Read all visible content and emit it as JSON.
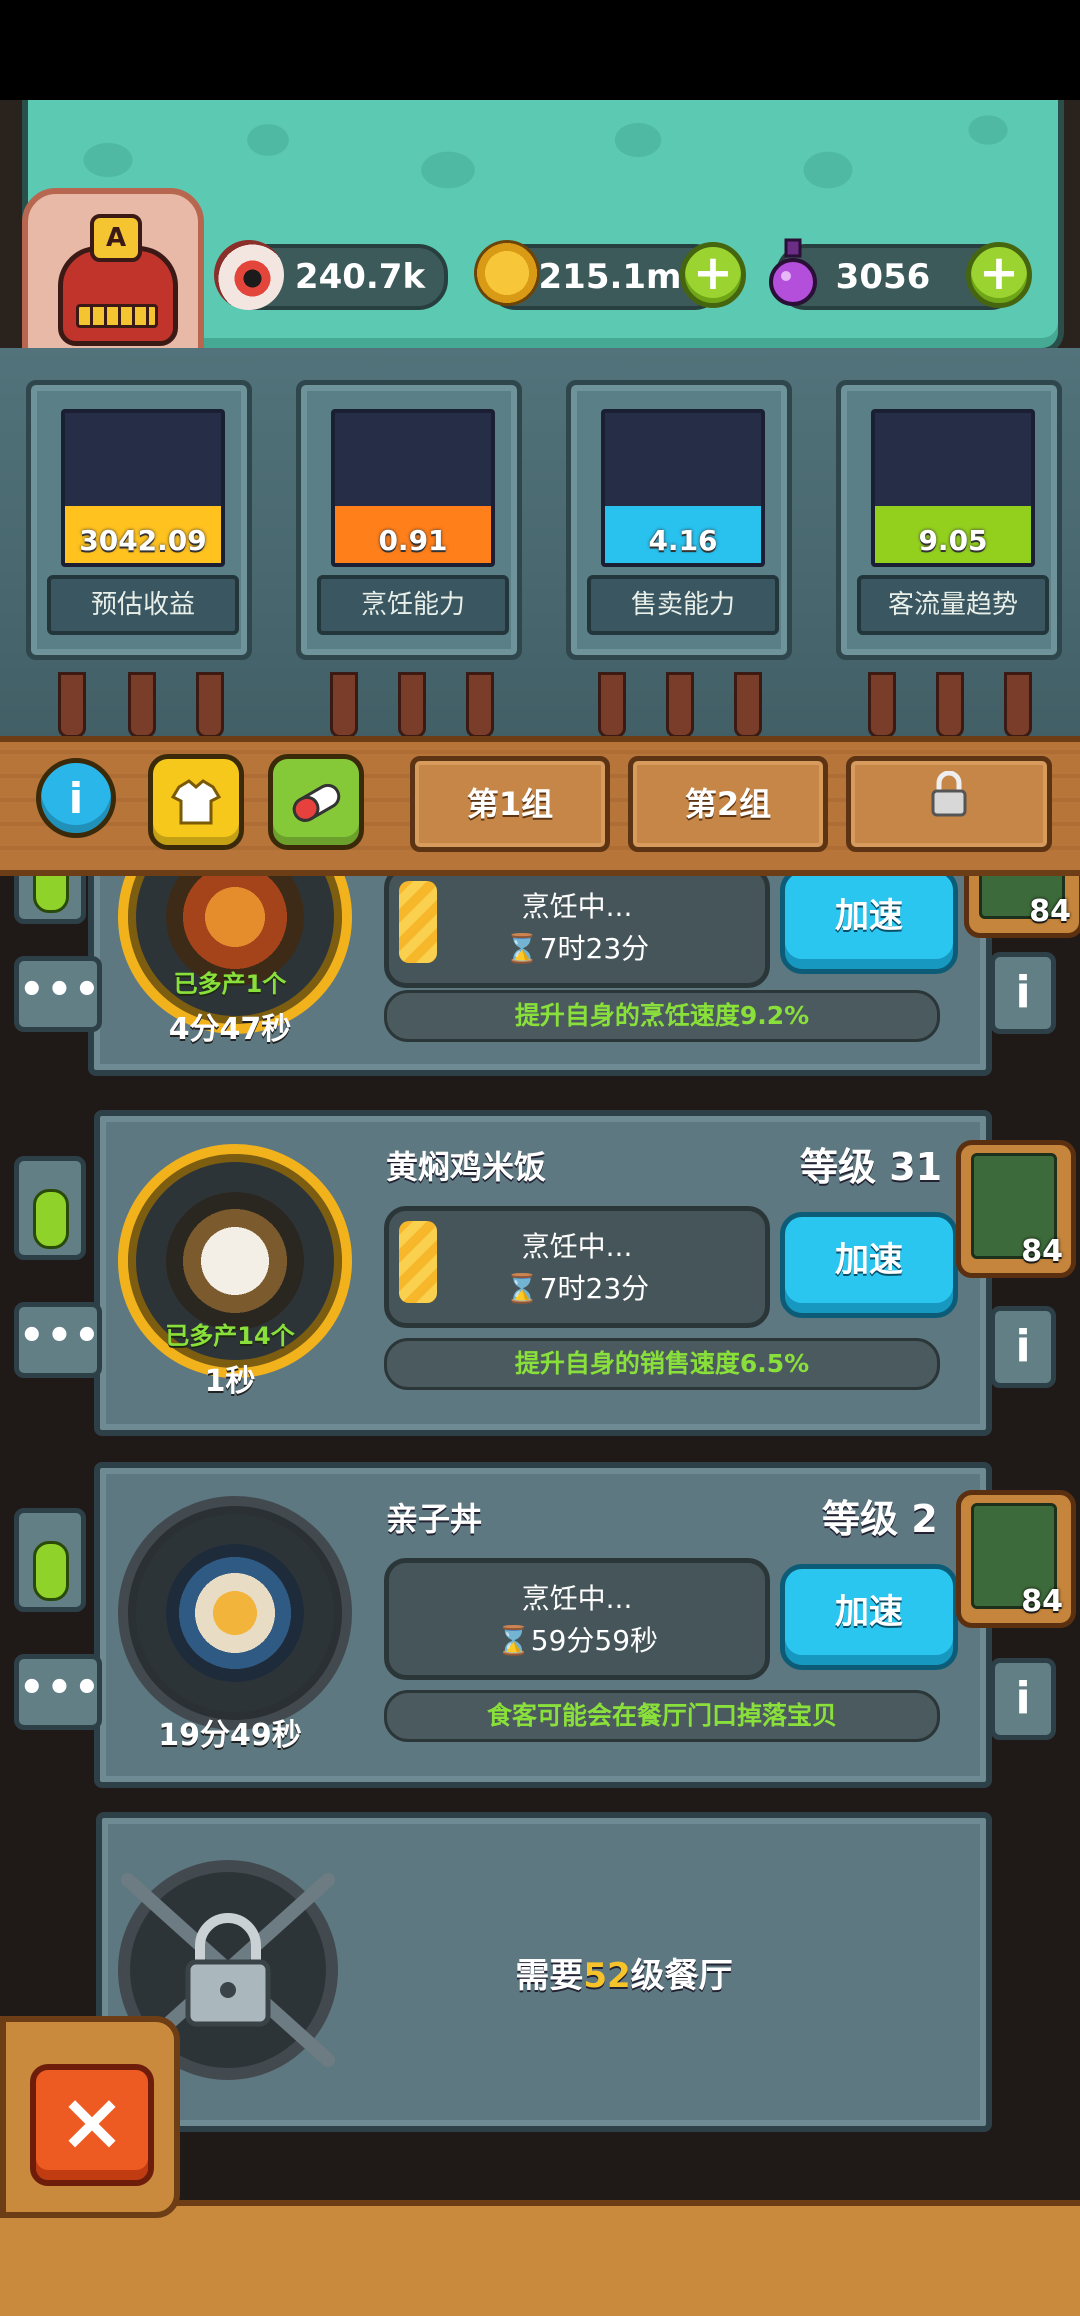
{
  "resources": {
    "eyes": "240.7k",
    "coins": "215.1m",
    "potions": "3056",
    "plus": "+"
  },
  "avatar": {
    "badge": "A"
  },
  "stats": [
    {
      "value": "3042.09",
      "label": "预估收益",
      "color": "#ffc21f",
      "fill": 0.38
    },
    {
      "value": "0.91",
      "label": "烹饪能力",
      "color": "#ff7f1a",
      "fill": 0.38
    },
    {
      "value": "4.16",
      "label": "售卖能力",
      "color": "#29c1ee",
      "fill": 0.38
    },
    {
      "value": "9.05",
      "label": "客流量趋势",
      "color": "#93d01e",
      "fill": 0.38
    }
  ],
  "toolbar": {
    "info_icon": "i",
    "groups": [
      "第1组",
      "第2组"
    ]
  },
  "kitchens": [
    {
      "bonus": "已多产1个",
      "timer": "4分47秒",
      "status": "烹饪中...",
      "cook_time": "⌛7时23分",
      "speed_label": "加速",
      "effect": "提升自身的烹饪速度9.2%",
      "card_count": "84",
      "dots": "•••",
      "info": "i"
    },
    {
      "name": "黄焖鸡米饭",
      "level": "等级 31",
      "bonus": "已多产14个",
      "timer": "1秒",
      "status": "烹饪中...",
      "cook_time": "⌛7时23分",
      "speed_label": "加速",
      "effect": "提升自身的销售速度6.5%",
      "card_count": "84",
      "dots": "•••",
      "info": "i"
    },
    {
      "name": "亲子丼",
      "level": "等级 2",
      "timer": "19分49秒",
      "status": "烹饪中...",
      "cook_time": "⌛59分59秒",
      "speed_label": "加速",
      "effect": "食客可能会在餐厅门口掉落宝贝",
      "card_count": "84",
      "dots": "•••",
      "info": "i"
    }
  ],
  "locked": {
    "prefix": "需要",
    "level": "52",
    "suffix": "级餐厅"
  },
  "close_label": "×"
}
